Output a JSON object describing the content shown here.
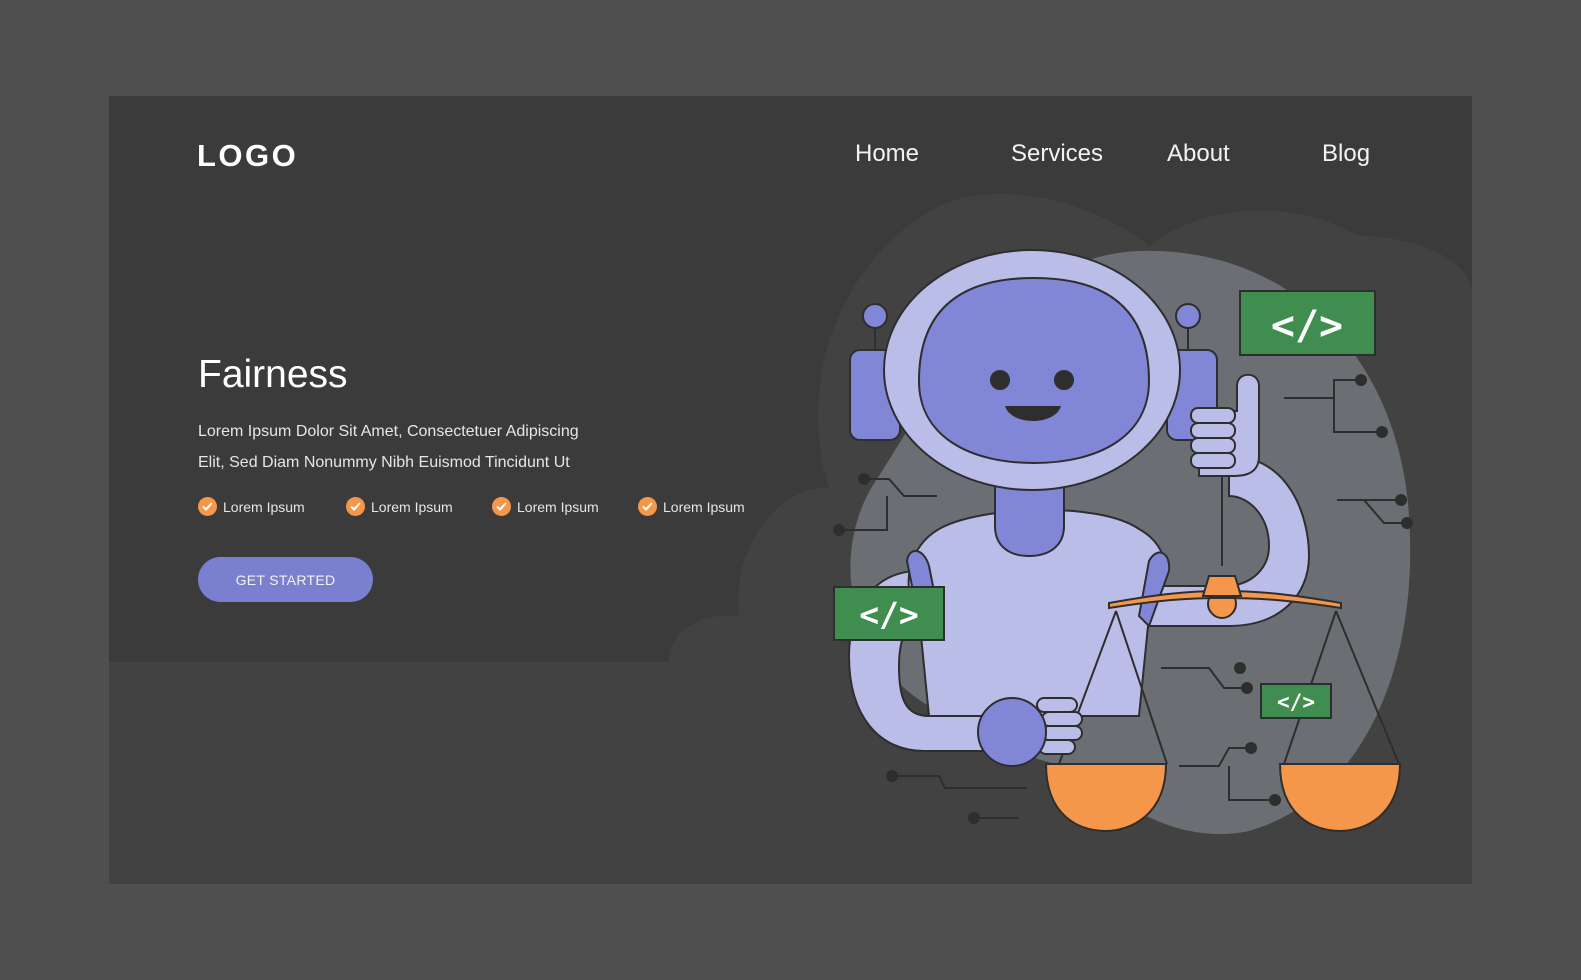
{
  "brand": {
    "logo_text": "LOGO"
  },
  "nav": {
    "items": [
      {
        "label": "Home"
      },
      {
        "label": "Services"
      },
      {
        "label": "About"
      },
      {
        "label": "Blog"
      }
    ]
  },
  "hero": {
    "title": "Fairness",
    "description_line1": "Lorem Ipsum Dolor Sit Amet, Consectetuer Adipiscing",
    "description_line2": "Elit, Sed Diam Nonummy Nibh Euismod Tincidunt Ut",
    "bullets": [
      {
        "label": "Lorem Ipsum"
      },
      {
        "label": "Lorem Ipsum"
      },
      {
        "label": "Lorem Ipsum"
      },
      {
        "label": "Lorem Ipsum"
      }
    ],
    "cta_label": "GET STARTED"
  },
  "illustration": {
    "code_tag_text": "</>",
    "icons": [
      "robot",
      "balance-scale",
      "code-tag",
      "circuit-lines"
    ]
  },
  "colors": {
    "page_bg": "#4f4f4f",
    "frame_bg": "#3b3b3b",
    "accent_purple": "#7b7fd0",
    "robot_light": "#bbbde9",
    "robot_face": "#8286d6",
    "scale_orange": "#f4974a",
    "code_green": "#3f8d4f",
    "check_orange": "#f4974a"
  }
}
